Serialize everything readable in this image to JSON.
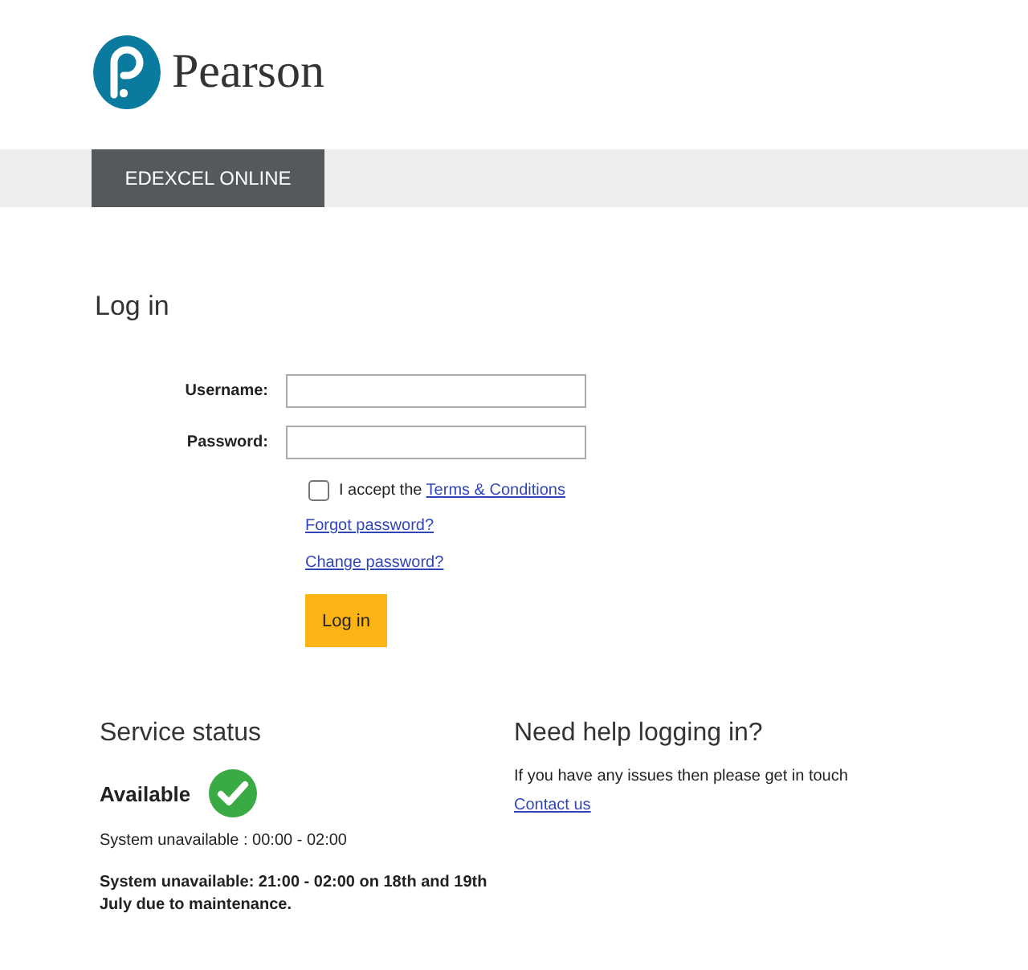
{
  "header": {
    "brand": "Pearson"
  },
  "nav": {
    "tabs": [
      {
        "label": "EDEXCEL ONLINE",
        "selected": true
      }
    ]
  },
  "login": {
    "title": "Log in",
    "fields": [
      {
        "label": "Username:"
      },
      {
        "label": "Password:"
      }
    ],
    "terms": {
      "checked": false,
      "text": "I accept the",
      "link": "Terms & Conditions"
    },
    "links": [
      "Forgot password?",
      "Change password?"
    ],
    "button": "Log in"
  },
  "service_status": {
    "title": "Service status",
    "status": "Available",
    "available": true,
    "notes": [
      {
        "text": "System unavailable : 00:00 - 02:00",
        "bold": false
      },
      {
        "text": "System unavailable: 21:00 - 02:00 on 18th and 19th July due to maintenance.",
        "bold": true
      }
    ]
  },
  "help": {
    "title": "Need help logging in?",
    "text": "If you have any issues then please get in touch",
    "link": "Contact us"
  }
}
